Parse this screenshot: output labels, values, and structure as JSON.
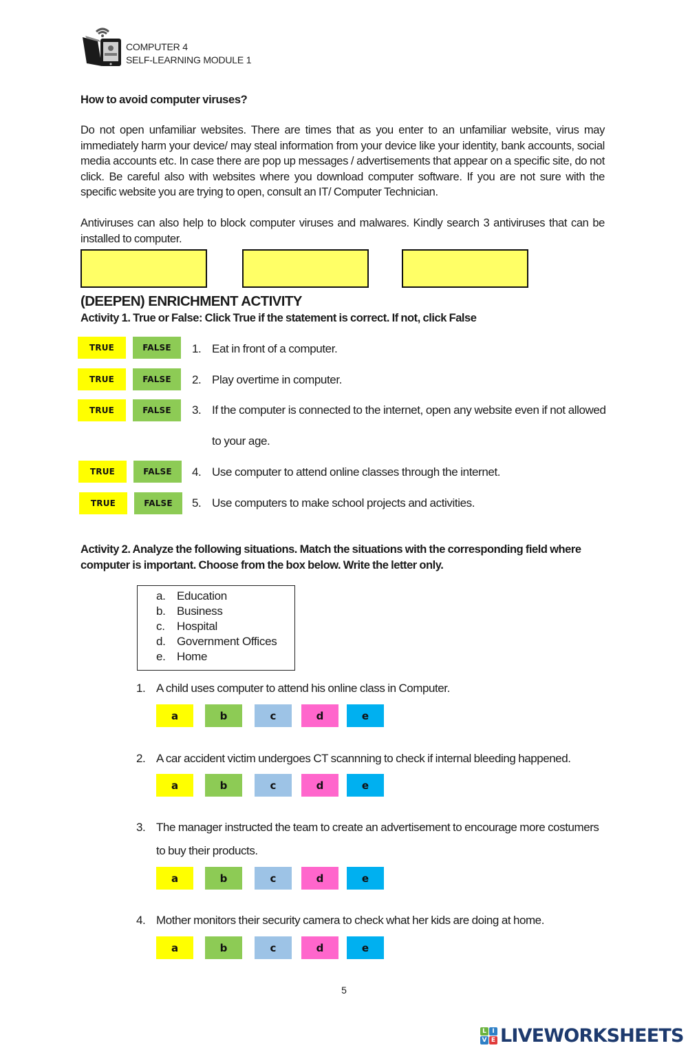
{
  "header": {
    "line1": "COMPUTER 4",
    "line2": "SELF-LEARNING MODULE 1",
    "logo_icon": "book-tablet-wifi-logo"
  },
  "avoid_section": {
    "heading": "How to avoid computer viruses?",
    "paragraph1": "Do not open unfamiliar websites. There are times that as you enter to an unfamiliar website, virus may immediately harm your device/ may steal information from your device like your identity, bank accounts, social media accounts etc. In case there are pop up messages / advertisements that appear on a specific site, do not click. Be careful also with websites where you download computer software. If you are not sure with the specific website you are trying to open, consult an IT/ Computer Technician.",
    "paragraph2": "Antiviruses can also help to block computer viruses and malwares. Kindly search 3 antiviruses that can be installed to computer.",
    "answer_boxes": [
      "",
      "",
      ""
    ]
  },
  "enrichment": {
    "title": "(DEEPEN) ENRICHMENT ACTIVITY",
    "activity1": {
      "title": "Activity 1. True or False: Click True if the statement is correct. If not, click False",
      "true_label": "TRUE",
      "false_label": "FALSE",
      "items": [
        {
          "num": "1.",
          "text": "Eat in front of a computer."
        },
        {
          "num": "2.",
          "text": "Play overtime in computer."
        },
        {
          "num": "3.",
          "text": "If the computer is connected to the internet, open any website even if not allowed",
          "text2": "to your age."
        },
        {
          "num": "4.",
          "text": "Use computer to attend online classes through the internet."
        },
        {
          "num": "5.",
          "text": "Use computers to make school projects and activities."
        }
      ]
    },
    "activity2": {
      "title_line1": "Activity 2. Analyze the following situations. Match the situations with the corresponding field where",
      "title_line2": "computer is important. Choose from the box below. Write the letter only.",
      "fields": [
        {
          "letter": "a.",
          "name": "Education"
        },
        {
          "letter": "b.",
          "name": "Business"
        },
        {
          "letter": "c.",
          "name": "Hospital"
        },
        {
          "letter": "d.",
          "name": "Government Offices"
        },
        {
          "letter": "e.",
          "name": "Home"
        }
      ],
      "choices": [
        "a",
        "b",
        "c",
        "d",
        "e"
      ],
      "choice_colors": {
        "a": "#ffff00",
        "b": "#8dcb55",
        "c": "#9dc3e6",
        "d": "#ff66cc",
        "e": "#00b0f0"
      },
      "questions": [
        {
          "num": "1.",
          "text": "A child uses computer to attend his online class in Computer."
        },
        {
          "num": "2.",
          "text": "A car accident victim undergoes CT scannning to check if internal bleeding happened."
        },
        {
          "num": "3.",
          "text": "The manager instructed the team to create an advertisement to encourage more costumers",
          "text2": "to buy their products."
        },
        {
          "num": "4.",
          "text": "Mother monitors their security camera to check what her kids are doing at home."
        }
      ]
    }
  },
  "footer": {
    "page_number": "5",
    "brand": {
      "tiles": [
        "L",
        "I",
        "V",
        "E"
      ],
      "tile_colors": [
        "#6cb33f",
        "#2f80c6",
        "#2f80c6",
        "#e03b3b"
      ],
      "wordmark": "LIVEWORKSHEETS"
    }
  }
}
